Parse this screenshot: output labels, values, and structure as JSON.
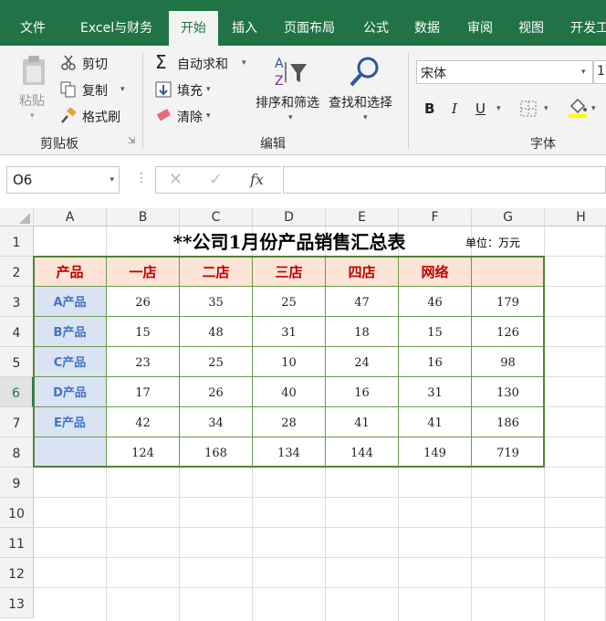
{
  "ribbon": {
    "tabs": [
      "文件",
      "Excel与财务",
      "开始",
      "插入",
      "页面布局",
      "公式",
      "数据",
      "审阅",
      "视图",
      "开发工"
    ],
    "active_tab": "开始",
    "clipboard": {
      "paste": "粘贴",
      "cut": "剪切",
      "copy": "复制",
      "format_painter": "格式刷",
      "group": "剪贴板"
    },
    "editing": {
      "autosum": "自动求和",
      "fill": "填充",
      "clear": "清除",
      "sort_filter": "排序和筛选",
      "find_select": "查找和选择",
      "group": "编辑"
    },
    "font": {
      "name": "宋体",
      "size": "1",
      "bold": "B",
      "italic": "I",
      "underline": "U",
      "group": "字体"
    }
  },
  "formula_bar": {
    "name_box": "O6",
    "cancel": "✕",
    "enter": "✓",
    "fx": "fx",
    "value": ""
  },
  "sheet": {
    "columns": [
      "A",
      "B",
      "C",
      "D",
      "E",
      "F",
      "G",
      "H"
    ],
    "rows": [
      "1",
      "2",
      "3",
      "4",
      "5",
      "6",
      "7",
      "8",
      "9",
      "10",
      "11",
      "12",
      "13"
    ],
    "selected_row": "6",
    "title": "**公司1月份产品销售汇总表",
    "unit": "单位：万元",
    "headers": [
      "产品",
      "一店",
      "二店",
      "三店",
      "四店",
      "网络",
      ""
    ],
    "data": [
      [
        "A产品",
        "26",
        "35",
        "25",
        "47",
        "46",
        "179"
      ],
      [
        "B产品",
        "15",
        "48",
        "31",
        "18",
        "15",
        "126"
      ],
      [
        "C产品",
        "23",
        "25",
        "10",
        "24",
        "16",
        "98"
      ],
      [
        "D产品",
        "17",
        "26",
        "40",
        "16",
        "31",
        "130"
      ],
      [
        "E产品",
        "42",
        "34",
        "28",
        "41",
        "41",
        "186"
      ],
      [
        "",
        "124",
        "168",
        "134",
        "144",
        "149",
        "719"
      ]
    ],
    "colors": {
      "header_fill": "#fce4d6",
      "product_fill": "#dae3f3",
      "header_text": "#c00000",
      "product_text": "#4472c4",
      "border": "#548235"
    }
  }
}
